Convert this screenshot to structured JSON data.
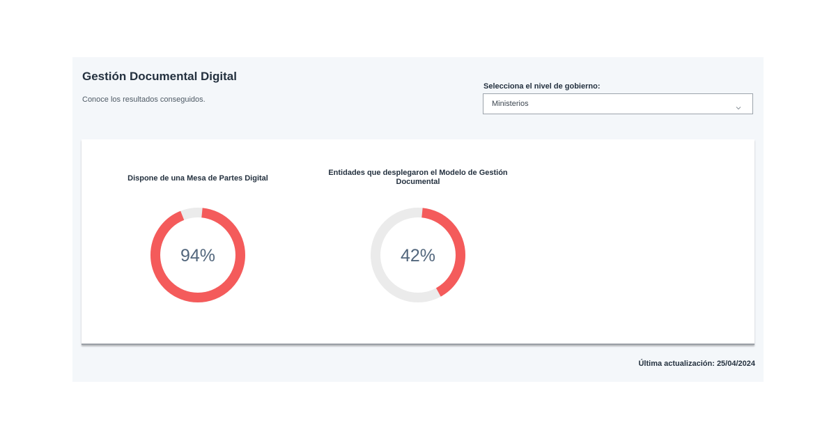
{
  "header": {
    "title": "Gestión Documental Digital",
    "subtitle": "Conoce los resultados conseguidos."
  },
  "filter": {
    "label": "Selecciona el nivel de gobierno:",
    "selected": "Ministerios",
    "icon": "chevron-down-icon"
  },
  "metrics": [
    {
      "title": "Dispone de una Mesa de Partes Digital",
      "value": 94,
      "value_label": "94%"
    },
    {
      "title": "Entidades que desplegaron el Modelo de Gestión Documental",
      "value": 42,
      "value_label": "42%"
    }
  ],
  "colors": {
    "accent": "#f45b5b",
    "track": "#ebebeb",
    "panel": "#f4f7fa",
    "value_text": "#52667c"
  },
  "footer": {
    "last_update": "Última actualización: 25/04/2024"
  }
}
